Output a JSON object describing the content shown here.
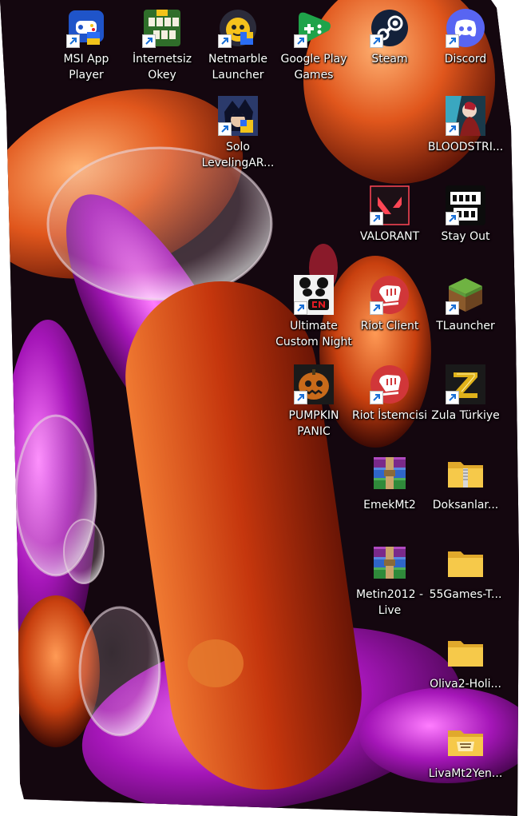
{
  "desktop": {
    "icons": [
      {
        "label": "MSI App Player",
        "icon": "msi-app-player-icon",
        "color": "#2a6df4"
      },
      {
        "label": "İnternetsiz Okey",
        "icon": "okey-icon",
        "color": "#2f7d2f"
      },
      {
        "label": "Netmarble Launcher",
        "icon": "netmarble-icon",
        "color": "#f2c31a"
      },
      {
        "label": "Google Play Games",
        "icon": "google-play-games-icon",
        "color": "#22a34a"
      },
      {
        "label": "Steam",
        "icon": "steam-icon",
        "color": "#1b2838"
      },
      {
        "label": "Discord",
        "icon": "discord-icon",
        "color": "#5865f2"
      },
      {
        "label": "Solo LevelingAR...",
        "icon": "solo-leveling-icon",
        "color": "#2b3a6b"
      },
      {
        "label": "BLOODSTRI...",
        "icon": "bloodstrike-icon",
        "color": "#8a1d1d"
      },
      {
        "label": "VALORANT",
        "icon": "valorant-icon",
        "color": "#ff4655"
      },
      {
        "label": "Stay Out",
        "icon": "stay-out-icon",
        "color": "#111111"
      },
      {
        "label": "Ultimate Custom Night",
        "icon": "ultimate-custom-night-icon",
        "color": "#e31b23"
      },
      {
        "label": "Riot Client",
        "icon": "riot-client-icon",
        "color": "#d13639"
      },
      {
        "label": "TLauncher",
        "icon": "tlauncher-icon",
        "color": "#5d9c3d"
      },
      {
        "label": "PUMPKIN PANIC",
        "icon": "pumpkin-panic-icon",
        "color": "#c86a1a"
      },
      {
        "label": "Riot İstemcisi",
        "icon": "riot-istemcisi-icon",
        "color": "#d13639"
      },
      {
        "label": "Zula Türkiye",
        "icon": "zula-icon",
        "color": "#e0b21a"
      },
      {
        "label": "EmekMt2",
        "icon": "winrar-archive-icon",
        "color": "#7a2a8a"
      },
      {
        "label": "Doksanlar...",
        "icon": "zip-folder-icon",
        "color": "#f4c542"
      },
      {
        "label": "Metin2012 - Live",
        "icon": "winrar-archive-icon",
        "color": "#7a2a8a"
      },
      {
        "label": "55Games-T...",
        "icon": "folder-icon",
        "color": "#f6c94a"
      },
      {
        "label": "Oliva2-Holi...",
        "icon": "folder-icon",
        "color": "#f6c94a"
      },
      {
        "label": "LivaMt2Yen...",
        "icon": "folder-icon",
        "color": "#f6c94a"
      }
    ]
  }
}
